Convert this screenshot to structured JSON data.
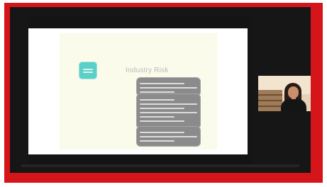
{
  "meeting": {
    "shared_slide": {
      "title": "Industry Risk"
    },
    "participant": {
      "tile_label": ""
    }
  },
  "colors": {
    "frame_red": "#d6151a",
    "dark_bg": "#161616",
    "slide_panel": "#fbfbeb",
    "risk_box_gray": "#8b8b8b",
    "icon_teal": "#5bcfc8"
  },
  "icons": [
    "document-icon"
  ]
}
